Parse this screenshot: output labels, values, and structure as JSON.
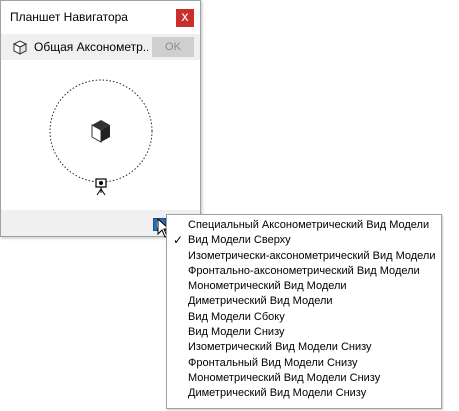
{
  "palette": {
    "title": "Планшет Навигатора",
    "close_glyph": "x",
    "view_icon": "box-icon",
    "current_view": "Общая Аксонометр...",
    "ok_label": "OK"
  },
  "menu": {
    "items": [
      {
        "label": "Специальный Аксонометрический Вид Модели",
        "checked": false
      },
      {
        "label": "Вид Модели Сверху",
        "checked": true
      },
      {
        "label": "Изометрически-аксонометрический Вид Модели",
        "checked": false
      },
      {
        "label": "Фронтально-аксонометрический Вид Модели",
        "checked": false
      },
      {
        "label": "Монометрический Вид Модели",
        "checked": false
      },
      {
        "label": "Диметрический Вид Модели",
        "checked": false
      },
      {
        "label": "Вид Модели Сбоку",
        "checked": false
      },
      {
        "label": "Вид Модели Снизу",
        "checked": false
      },
      {
        "label": "Изометрический Вид Модели Снизу",
        "checked": false
      },
      {
        "label": "Фронтальный Вид Модели Снизу",
        "checked": false
      },
      {
        "label": "Монометрический Вид Модели Снизу",
        "checked": false
      },
      {
        "label": "Диметрический Вид Модели Снизу",
        "checked": false
      }
    ],
    "check_glyph": "✓"
  },
  "colors": {
    "close_button": "#c9302c",
    "menu_button": "#2d6db5",
    "panel_gray": "#f0f0f0"
  }
}
